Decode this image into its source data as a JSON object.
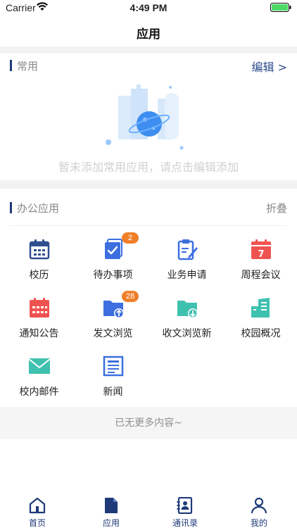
{
  "status_bar": {
    "carrier": "Carrier",
    "time": "4:49 PM"
  },
  "nav": {
    "title": "应用"
  },
  "common": {
    "title": "常用",
    "edit_label": "编辑 >",
    "empty_text": "暂未添加常用应用，请点击编辑添加"
  },
  "office": {
    "title": "办公应用",
    "collapse_label": "折叠",
    "apps": [
      {
        "label": "校历",
        "icon": "calendar-icon",
        "badge": ""
      },
      {
        "label": "待办事项",
        "icon": "todo-icon",
        "badge": "2"
      },
      {
        "label": "业务申请",
        "icon": "clipboard-edit-icon",
        "badge": ""
      },
      {
        "label": "周程会议",
        "icon": "calendar-7-icon",
        "badge": ""
      },
      {
        "label": "通知公告",
        "icon": "notice-calendar-icon",
        "badge": ""
      },
      {
        "label": "发文浏览",
        "icon": "folder-upload-icon",
        "badge": "28"
      },
      {
        "label": "收文浏览新",
        "icon": "folder-download-icon",
        "badge": ""
      },
      {
        "label": "校园概况",
        "icon": "building-icon",
        "badge": ""
      },
      {
        "label": "校内邮件",
        "icon": "mail-icon",
        "badge": ""
      },
      {
        "label": "新闻",
        "icon": "newspaper-icon",
        "badge": ""
      }
    ]
  },
  "footer": {
    "no_more": "已无更多内容~"
  },
  "tabs": [
    {
      "label": "首页",
      "icon": "home-icon"
    },
    {
      "label": "应用",
      "icon": "document-icon"
    },
    {
      "label": "通讯录",
      "icon": "contacts-icon"
    },
    {
      "label": "我的",
      "icon": "user-icon"
    }
  ],
  "colors": {
    "accent": "#1f3a78",
    "badge": "#f07f2a",
    "blue": "#3d6fe0",
    "red": "#ef5350",
    "teal": "#3fc1b0"
  }
}
